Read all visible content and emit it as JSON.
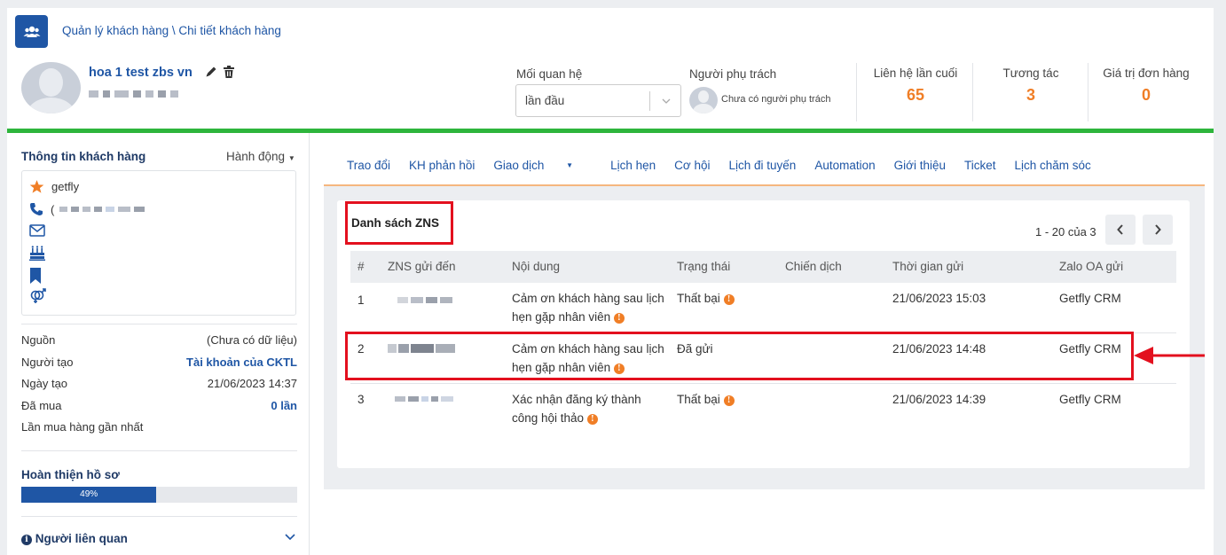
{
  "breadcrumb": "Quản lý khách hàng \\ Chi tiết khách hàng",
  "customer": {
    "name": "hoa 1 test zbs vn"
  },
  "relationship": {
    "label": "Mối quan hệ",
    "value": "lần đầu"
  },
  "owner": {
    "label": "Người phụ trách",
    "value": "Chưa có người phụ trách"
  },
  "stats": [
    {
      "label": "Liên hệ lần cuối",
      "value": "65"
    },
    {
      "label": "Tương tác",
      "value": "3"
    },
    {
      "label": "Giá trị đơn hàng",
      "value": "0"
    }
  ],
  "sidebar": {
    "title": "Thông tin khách hàng",
    "action": "Hành động",
    "info": {
      "tag": "getfly",
      "phone_prefix": "("
    },
    "fields": [
      {
        "key": "Nguồn",
        "value": "(Chưa có dữ liệu)"
      },
      {
        "key": "Người tạo",
        "value": "Tài khoản của CKTL"
      },
      {
        "key": "Ngày tạo",
        "value": "21/06/2023 14:37"
      },
      {
        "key": "Đã mua",
        "value": "0 lần"
      },
      {
        "key": "Lần mua hàng gần nhất",
        "value": ""
      }
    ],
    "profile_title": "Hoàn thiện hồ sơ",
    "profile_percent": "49%",
    "profile_fraction": 0.49,
    "related": "Người liên quan"
  },
  "tabs": [
    "Trao đổi",
    "KH phản hồi",
    "Giao dịch",
    "Lịch hẹn",
    "Cơ hội",
    "Lịch đi tuyến",
    "Automation",
    "Giới thiệu",
    "Ticket",
    "Lịch chăm sóc"
  ],
  "zns": {
    "title": "Danh sách ZNS",
    "pager": "1 - 20 của 3",
    "columns": [
      "#",
      "ZNS gửi đến",
      "Nội dung",
      "Trạng thái",
      "Chiến dịch",
      "Thời gian gửi",
      "Zalo OA gửi"
    ],
    "rows": [
      {
        "no": "1",
        "content": "Cảm ơn khách hàng sau lịch hẹn gặp nhân viên",
        "status": "Thất bại",
        "campaign": "",
        "time": "21/06/2023 15:03",
        "oa": "Getfly CRM"
      },
      {
        "no": "2",
        "content": "Cảm ơn khách hàng sau lịch hẹn gặp nhân viên",
        "status": "Đã gửi",
        "campaign": "",
        "time": "21/06/2023 14:48",
        "oa": "Getfly CRM"
      },
      {
        "no": "3",
        "content": "Xác nhận đăng ký thành công hội thảo",
        "status": "Thất bại",
        "campaign": "",
        "time": "21/06/2023 14:39",
        "oa": "Getfly CRM"
      }
    ]
  },
  "colors": {
    "brand": "#1f56a5",
    "accent": "#f07e26",
    "success": "#2db53c",
    "highlight": "#e3101e"
  },
  "icons": [
    "users-icon",
    "pencil-icon",
    "trash-icon",
    "star-icon",
    "phone-icon",
    "envelope-icon",
    "birthday-cake-icon",
    "bookmark-icon",
    "gender-icon",
    "info-circle-icon",
    "chevron-left-icon",
    "chevron-right-icon",
    "chevron-down-icon"
  ]
}
